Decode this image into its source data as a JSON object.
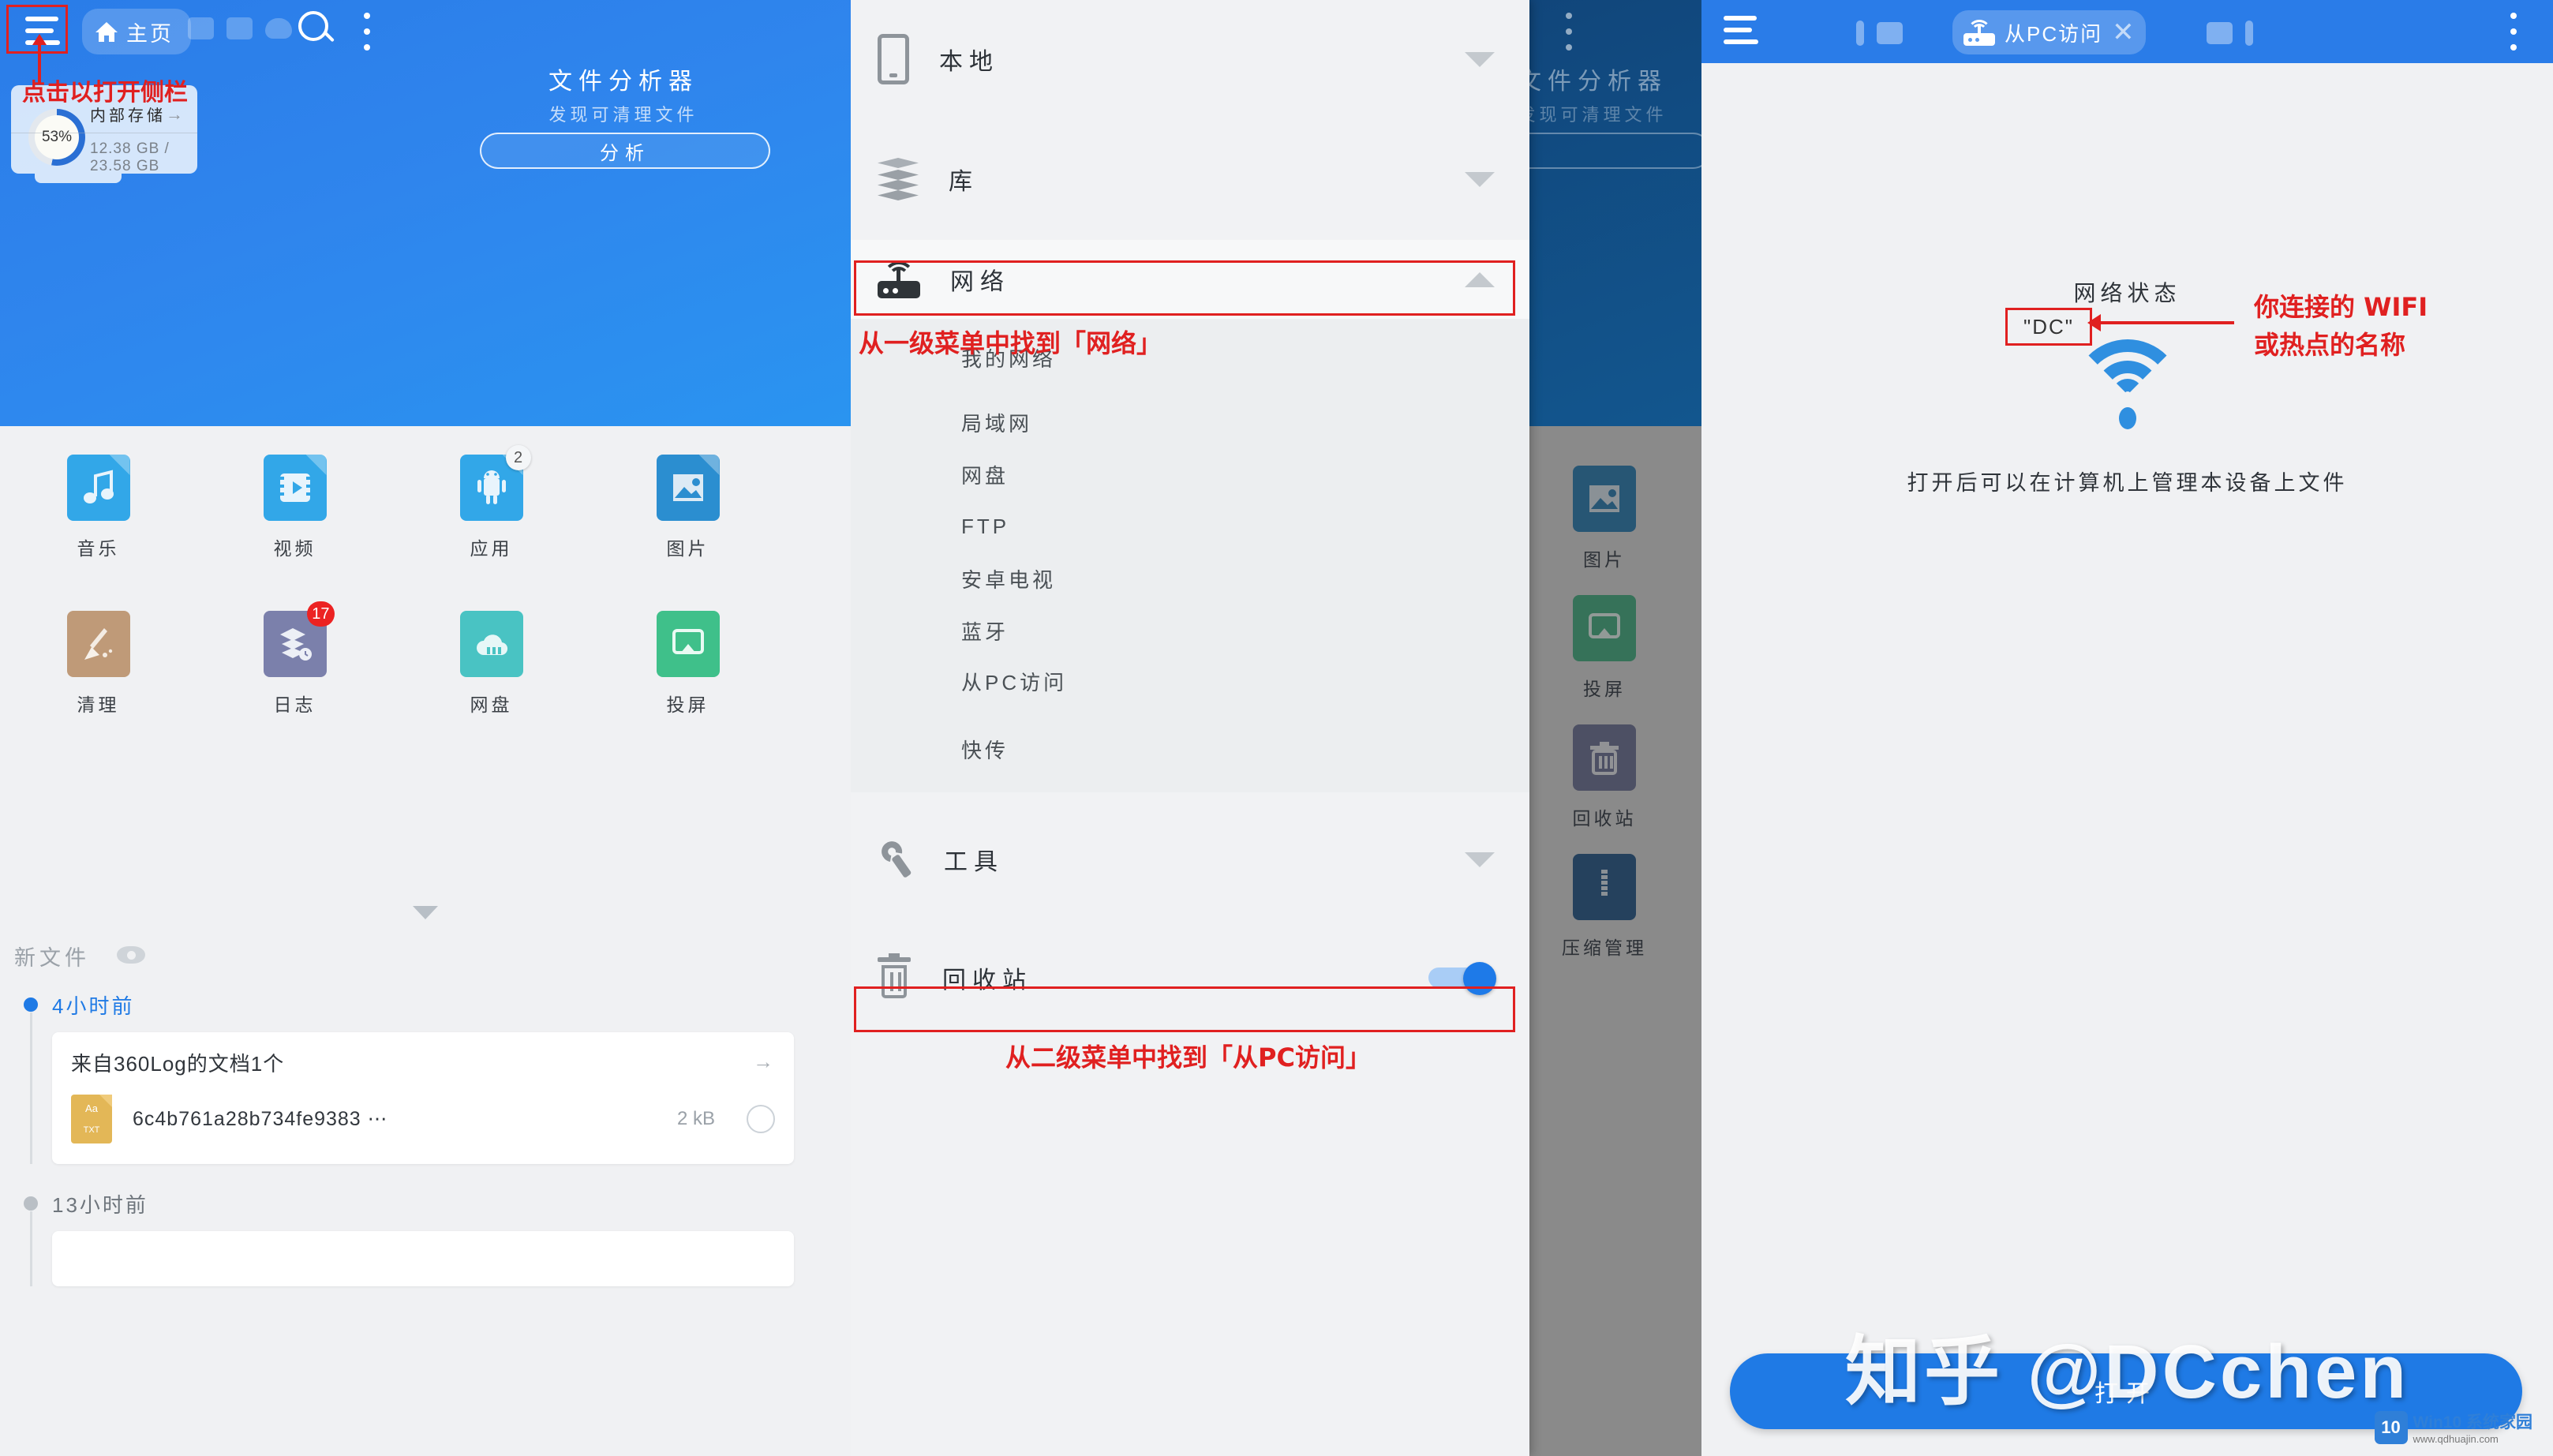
{
  "panel1": {
    "topbar": {
      "menu_icon": "hamburger-icon",
      "tab_home_label": "主页",
      "search_icon": "search-icon",
      "overflow_icon": "kebab-menu-icon"
    },
    "hero": {
      "title": "文件分析器",
      "subtitle": "发现可清理文件",
      "analyze_button": "分析"
    },
    "storage_card": {
      "percent": "53%",
      "percent_value": 53,
      "name": "内部存储",
      "size": "12.38 GB / 23.58 GB"
    },
    "annotation": "点击以打开侧栏",
    "grid": [
      {
        "label": "音乐",
        "icon": "music-note-icon",
        "glyph": "♫",
        "color": "#32a7e8",
        "badge": ""
      },
      {
        "label": "视频",
        "icon": "video-film-icon",
        "glyph": "▶",
        "color": "#32a7e8",
        "badge": ""
      },
      {
        "label": "应用",
        "icon": "android-robot-icon",
        "glyph": "▢",
        "color": "#32a7e8",
        "badge": "2"
      },
      {
        "label": "图片",
        "icon": "image-picture-icon",
        "glyph": "◰",
        "color": "#2b8ed0",
        "badge": ""
      },
      {
        "label": "清理",
        "icon": "broom-clean-icon",
        "glyph": "✐",
        "color": "#bf9a78",
        "badge": ""
      },
      {
        "label": "日志",
        "icon": "layers-log-icon",
        "glyph": "◆",
        "color": "#7b80ab",
        "badge": "17"
      },
      {
        "label": "网盘",
        "icon": "cloud-drive-icon",
        "glyph": "☁",
        "color": "#49c3c3",
        "badge": ""
      },
      {
        "label": "投屏",
        "icon": "cast-screen-icon",
        "glyph": "△",
        "color": "#3fc08a",
        "badge": ""
      }
    ],
    "newfiles_label": "新文件",
    "timeline": [
      {
        "time": "4小时前",
        "color": "#1f7ae5",
        "active": true
      },
      {
        "time": "13小时前",
        "color": "#b9bfc5",
        "active": false
      }
    ],
    "file_card": {
      "title": "来自360Log的文档1个",
      "file_name": "6c4b761a28b734fe9383 ⋯",
      "file_size": "2 kB",
      "file_type": "TXT",
      "file_type_sub": "Aa"
    }
  },
  "panel2": {
    "background": {
      "title": "文件分析器",
      "subtitle": "发现可清理文件",
      "items": [
        {
          "label": "图片",
          "color": "#2b8ed0",
          "glyph": "◰"
        },
        {
          "label": "投屏",
          "color": "#3fc08a",
          "glyph": "△"
        },
        {
          "label": "回收站",
          "color": "#7b80ab",
          "glyph": "Ὕ1"
        },
        {
          "label": "压缩管理",
          "color": "#2f6ba8",
          "glyph": "❘"
        }
      ]
    },
    "drawer": {
      "sections": [
        {
          "label": "本地",
          "icon": "phone-device-icon",
          "expanded": false
        },
        {
          "label": "库",
          "icon": "layers-library-icon",
          "expanded": false
        },
        {
          "label": "网络",
          "icon": "router-network-icon",
          "expanded": true,
          "highlighted": true
        }
      ],
      "network_children": [
        "我的网络",
        "局域网",
        "网盘",
        "FTP",
        "安卓电视",
        "蓝牙",
        "从PC访问",
        "快传"
      ],
      "highlighted_child": "从PC访问",
      "tools_label": "工具",
      "tools_icon": "wrench-tools-icon",
      "recycle_label": "回收站",
      "recycle_icon": "trash-bin-icon",
      "recycle_toggle_on": true
    },
    "annotations": {
      "first": "从一级菜单中找到「网络」",
      "second": "从二级菜单中找到「从PC访问」"
    }
  },
  "panel3": {
    "topbar": {
      "menu_icon": "hamburger-icon",
      "tab_label": "从PC访问",
      "tab_icon": "router-network-icon",
      "close_icon": "close-x-icon",
      "overflow_icon": "kebab-menu-icon"
    },
    "network_status_label": "网络状态",
    "ssid": "\"DC\"",
    "wifi_icon": "wifi-signal-icon",
    "description": "打开后可以在计算机上管理本设备上文件",
    "annotation_line1": "你连接的 WIFI",
    "annotation_line2": "或热点的名称",
    "open_button": "打开",
    "watermark": "知乎 @DCchen",
    "watermark2": {
      "logo": "10",
      "title": "Win10 系统家园",
      "url": "www.qdhuajin.com"
    }
  },
  "colors": {
    "brand_blue": "#2a7ce8",
    "accent_red": "#e02020",
    "toggle_on": "#1e7ae8",
    "badge_red": "#ec2222"
  }
}
